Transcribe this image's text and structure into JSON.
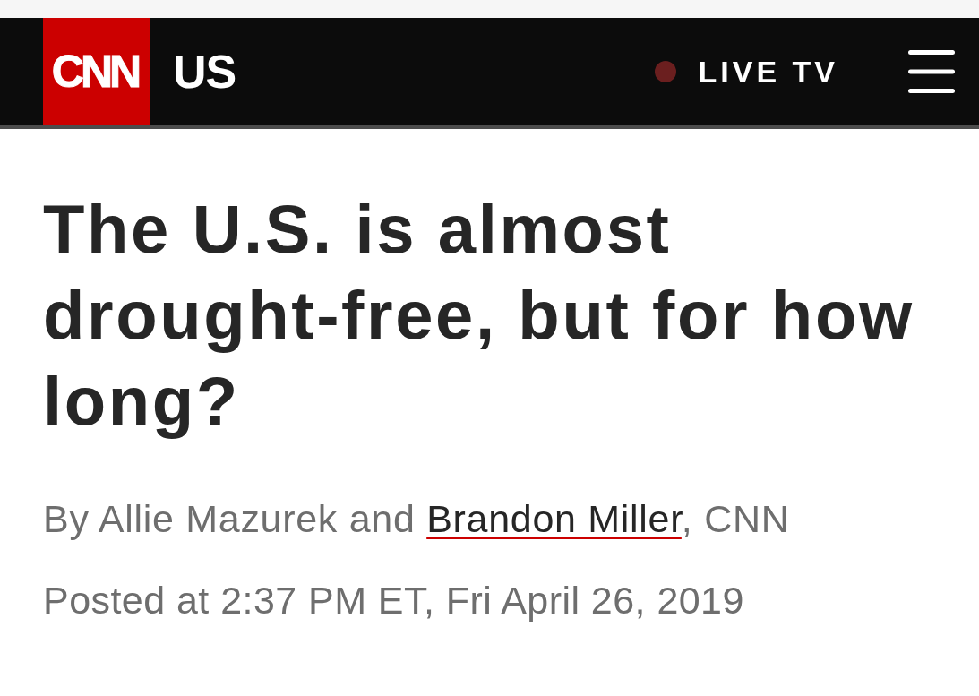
{
  "header": {
    "logo": "CNN",
    "section": "US",
    "live_tv": "LIVE TV"
  },
  "article": {
    "headline": "The U.S. is almost drought-free, but for how long?",
    "byline": [
      {
        "kind": "text",
        "text": "By Allie Mazurek and "
      },
      {
        "kind": "link",
        "text": "Brandon Miller"
      },
      {
        "kind": "text",
        "text": ", CNN"
      }
    ],
    "posted": "Posted at 2:37 PM ET, Fri April 26, 2019"
  }
}
